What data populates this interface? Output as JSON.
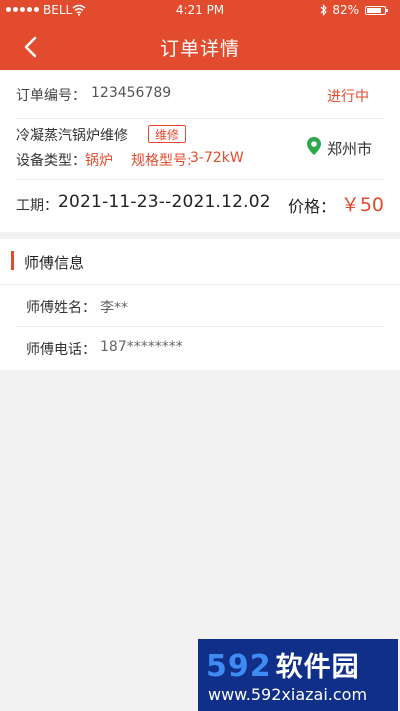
{
  "status_bar": {
    "carrier": "BELL",
    "time": "4:21 PM",
    "battery_percent": "82%",
    "battery_level": 0.82,
    "icons": [
      "signal-dots-icon",
      "wifi-icon",
      "bluetooth-icon",
      "battery-icon"
    ]
  },
  "nav": {
    "title": "订单详情",
    "back_icon": "chevron-left-icon"
  },
  "order": {
    "number_label": "订单编号：",
    "number_value": "123456789",
    "status": "进行中",
    "service_name": "冷凝蒸汽锅炉维修",
    "service_tag": "维修",
    "device_type_label": "设备类型：",
    "device_type_value": "锅炉",
    "spec_label": "规格型号:",
    "spec_value": "3-72kW",
    "location": "郑州市",
    "location_icon": "map-pin-icon",
    "period_label": "工期：",
    "period_value": "2021-11-23--2021.12.02",
    "price_label": "价格：",
    "price_value": "￥50"
  },
  "master": {
    "section_title": "师傅信息",
    "name_label": "师傅姓名：",
    "name_value": "李**",
    "phone_label": "师傅电话：",
    "phone_value": "187********"
  },
  "watermark": {
    "main_text": "592",
    "main_text_cn": "软件园",
    "sub_text": "www.592xiazai.com"
  },
  "colors": {
    "accent": "#e34b2e",
    "background": "#f2f2f2",
    "location_pin": "#2ea84a",
    "watermark_bg": "#0f2f88",
    "watermark_blue": "#3e8bf3"
  }
}
